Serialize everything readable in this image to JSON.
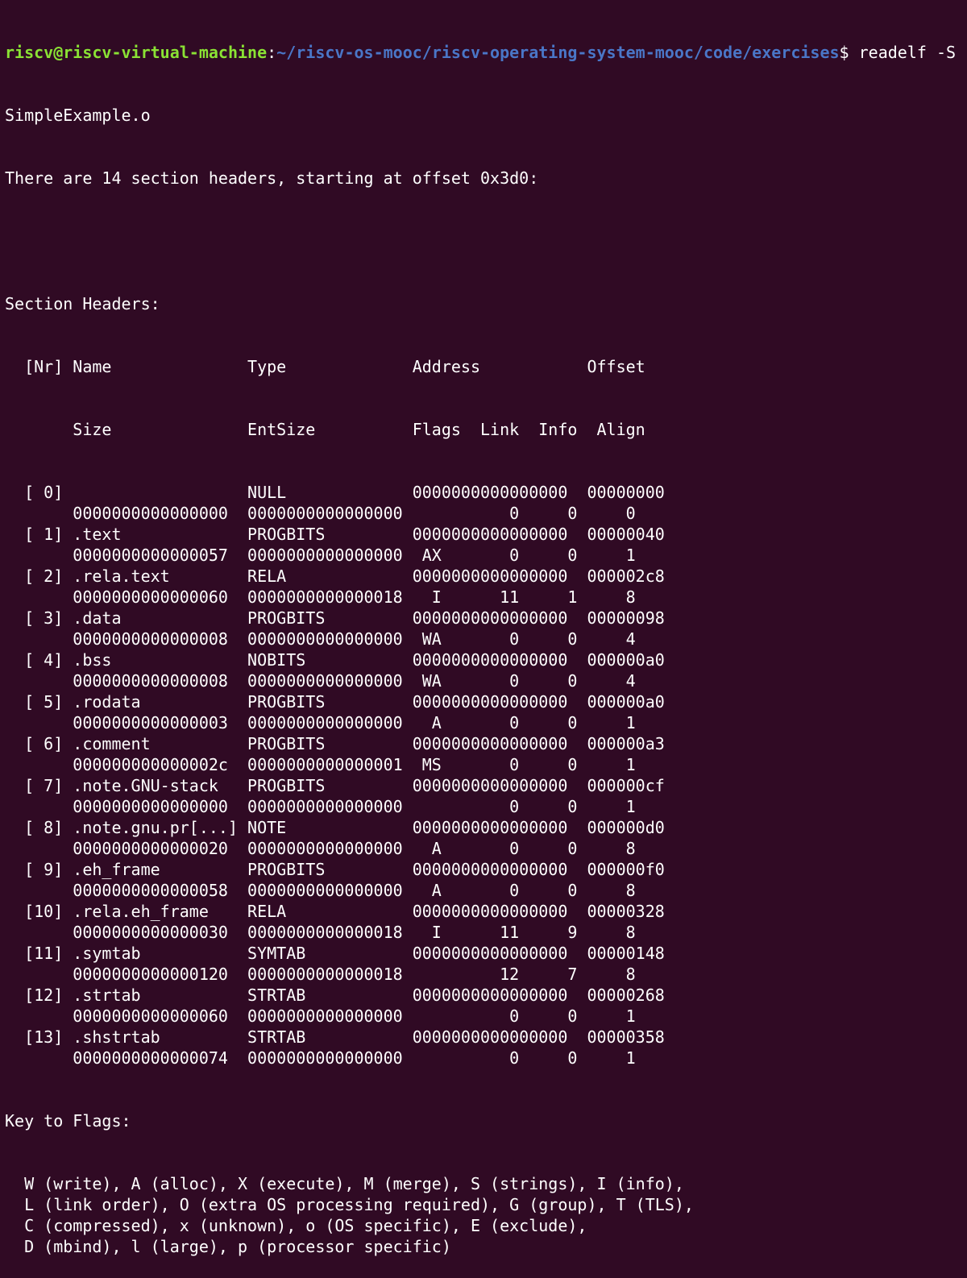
{
  "prompt": {
    "user_host": "riscv@riscv-virtual-machine",
    "separator": ":",
    "path": "~/riscv-os-mooc/riscv-operating-system-mooc/code/exercises",
    "symbol": "$",
    "command_first": " readelf -S",
    "command_cont": "SimpleExample.o"
  },
  "output": {
    "summary": "There are 14 section headers, starting at offset 0x3d0:",
    "heading": "Section Headers:",
    "col_header_1": "  [Nr] Name              Type             Address           Offset",
    "col_header_2": "       Size              EntSize          Flags  Link  Info  Align",
    "rows": [
      "  [ 0]                   NULL             0000000000000000  00000000",
      "       0000000000000000  0000000000000000           0     0     0",
      "  [ 1] .text             PROGBITS         0000000000000000  00000040",
      "       0000000000000057  0000000000000000  AX       0     0     1",
      "  [ 2] .rela.text        RELA             0000000000000000  000002c8",
      "       0000000000000060  0000000000000018   I      11     1     8",
      "  [ 3] .data             PROGBITS         0000000000000000  00000098",
      "       0000000000000008  0000000000000000  WA       0     0     4",
      "  [ 4] .bss              NOBITS           0000000000000000  000000a0",
      "       0000000000000008  0000000000000000  WA       0     0     4",
      "  [ 5] .rodata           PROGBITS         0000000000000000  000000a0",
      "       0000000000000003  0000000000000000   A       0     0     1",
      "  [ 6] .comment          PROGBITS         0000000000000000  000000a3",
      "       000000000000002c  0000000000000001  MS       0     0     1",
      "  [ 7] .note.GNU-stack   PROGBITS         0000000000000000  000000cf",
      "       0000000000000000  0000000000000000           0     0     1",
      "  [ 8] .note.gnu.pr[...] NOTE             0000000000000000  000000d0",
      "       0000000000000020  0000000000000000   A       0     0     8",
      "  [ 9] .eh_frame         PROGBITS         0000000000000000  000000f0",
      "       0000000000000058  0000000000000000   A       0     0     8",
      "  [10] .rela.eh_frame    RELA             0000000000000000  00000328",
      "       0000000000000030  0000000000000018   I      11     9     8",
      "  [11] .symtab           SYMTAB           0000000000000000  00000148",
      "       0000000000000120  0000000000000018          12     7     8",
      "  [12] .strtab           STRTAB           0000000000000000  00000268",
      "       0000000000000060  0000000000000000           0     0     1",
      "  [13] .shstrtab         STRTAB           0000000000000000  00000358",
      "       0000000000000074  0000000000000000           0     0     1"
    ],
    "key_heading": "Key to Flags:",
    "key_lines": [
      "  W (write), A (alloc), X (execute), M (merge), S (strings), I (info),",
      "  L (link order), O (extra OS processing required), G (group), T (TLS),",
      "  C (compressed), x (unknown), o (OS specific), E (exclude),",
      "  D (mbind), l (large), p (processor specific)"
    ]
  },
  "colors": {
    "background": "#300a24",
    "text": "#ffffff",
    "prompt_user": "#8ae234",
    "prompt_path": "#4a76c7"
  }
}
